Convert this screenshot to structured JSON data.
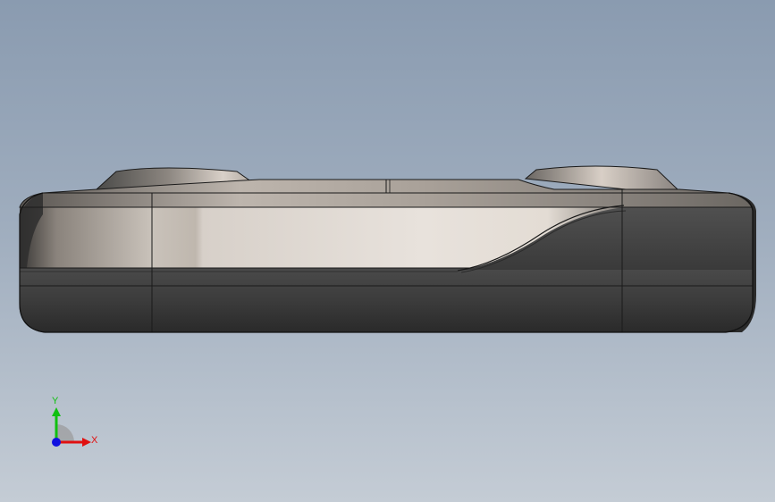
{
  "viewport": {
    "background_top": "#8a9bb0",
    "background_bottom": "#c4ccd5"
  },
  "model": {
    "body_light": "#e6e0da",
    "body_dark": "#3c3c3c",
    "edge": "#1a1a1a"
  },
  "triad": {
    "x_label": "X",
    "y_label": "Y",
    "x_color": "#e01010",
    "y_color": "#10c010",
    "z_color": "#1010e0"
  }
}
